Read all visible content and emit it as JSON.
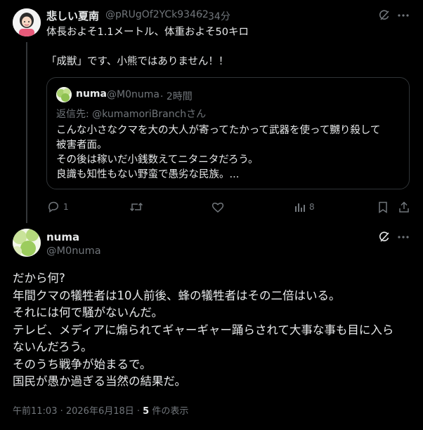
{
  "reply_post": {
    "display_name": "悲しい夏南",
    "handle": "@pRUgOf2YCk93462",
    "separator": "·",
    "time_ago": "34分",
    "lines": [
      "体長およそ1.1メートル、体重およそ50キロ",
      "「成獣」です、小熊ではありません！！"
    ],
    "quote": {
      "display_name": "numa",
      "handle": "@M0numa",
      "time_ago": "· 2時間",
      "reply_to": "返信先: @kumamoriBranchさん",
      "lines": [
        "こんな小さなクマを大の大人が寄ってたかって武器を使って嬲り殺して",
        "被害者面。",
        "その後は稼いだ小銭数えてニタニタだろう。",
        "良識も知性もない野蛮で愚劣な民族。..."
      ]
    },
    "actions": {
      "reply_count": "1",
      "retweet_count": "",
      "like_count": "",
      "view_count": "8"
    }
  },
  "main_post": {
    "display_name": "numa",
    "handle": "@M0numa",
    "lines": [
      "だから何?",
      "年間クマの犠牲者は10人前後、蜂の犠牲者はその二倍はいる。",
      "それには何で騒がないんだ。",
      "テレビ、メディアに煽られてギャーギャー踊らされて大事な事も目に入ら",
      "ないんだろう。",
      "そのうち戦争が始まるで。",
      "国民が愚か過ぎる当然の結果だ。"
    ],
    "timestamp": "午前11:03 · 2026年6月18日 · ",
    "view_number": "5",
    "view_label": " 件の表示"
  },
  "icons": {
    "grok": "grok-icon",
    "more": "more-icon",
    "reply": "reply-icon",
    "retweet": "retweet-icon",
    "like": "like-icon",
    "views": "views-icon",
    "bookmark": "bookmark-icon",
    "share": "share-icon"
  },
  "colors": {
    "background": "#000000",
    "text": "#e7e9ea",
    "muted": "#71767b",
    "border": "#2f3336"
  }
}
